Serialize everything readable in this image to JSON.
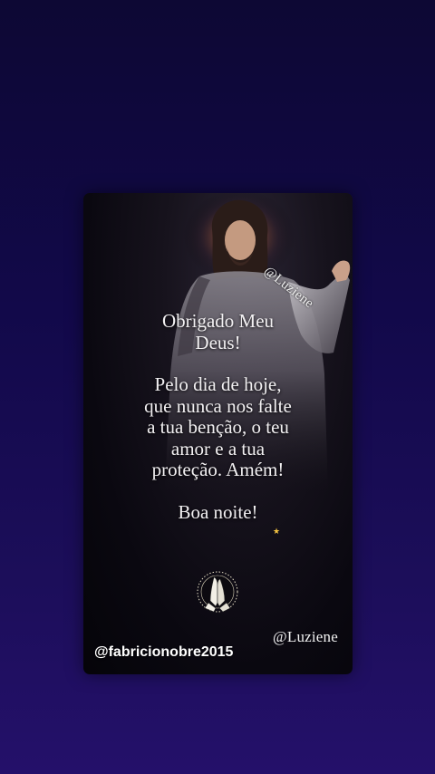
{
  "card": {
    "watermark_diagonal": "@Luziene",
    "message_lines_top": [
      "Obrigado Meu",
      "Deus!"
    ],
    "message_lines_middle": [
      "Pelo dia de hoje,",
      "que nunca nos falte",
      "a tua benção, o teu",
      "amor e a tua",
      "proteção. Amém!"
    ],
    "message_lines_bottom": [
      "Boa noite!"
    ],
    "signature": "@Luziene"
  },
  "overlay": {
    "username": "@fabricionobre2015"
  },
  "colors": {
    "background_top": "#0d0834",
    "background_bottom": "#24106a",
    "text": "#f2f0f2",
    "star": "#f5c542"
  },
  "icons": [
    "praying-hands-icon",
    "sparkle-star-icon"
  ]
}
